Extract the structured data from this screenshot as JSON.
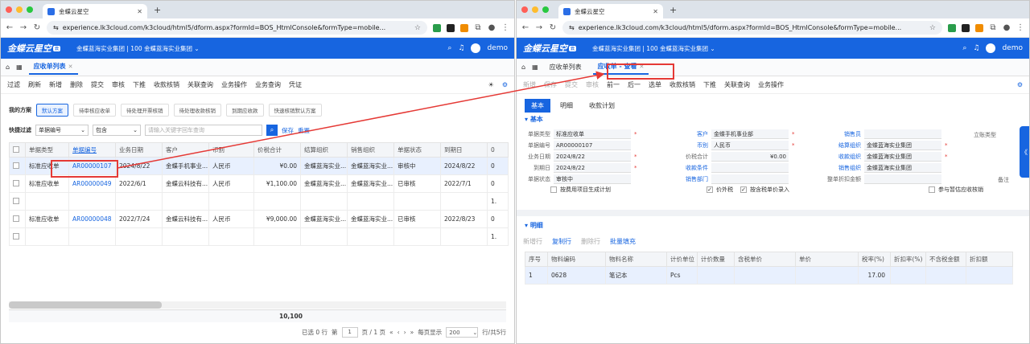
{
  "browser": {
    "tab_title": "金蝶云星空",
    "url": "experience.lk3cloud.com/k3cloud/html5/dform.aspx?formId=BOS_HtmlConsole&formType=mobile...",
    "traffic_colors": [
      "#ff5f57",
      "#febc2e",
      "#28c840"
    ]
  },
  "app": {
    "logo_text": "金蝶云星空",
    "logo_badge": "云",
    "org_label": "金蝶蓝海实业集团 | 100 金蝶蓝海实业集团",
    "org_chevron": "⌄",
    "user": "demo",
    "accent": "#1765e0",
    "highlight": "#e53935"
  },
  "left": {
    "page_tab": "应收单列表",
    "toolbar": [
      "过滤",
      "刷新",
      "新增",
      "删除",
      "提交",
      "审核",
      "下推",
      "收款核销",
      "关联查询",
      "业务操作",
      "业务查询",
      "凭证"
    ],
    "scheme_label": "我的方案",
    "schemes": [
      "默认方案",
      "待审核应收单",
      "待处理开票核销",
      "待处理收款核销",
      "到期应收款",
      "快速核销默认方案"
    ],
    "quick_filter_label": "快捷过滤",
    "filter_field": "单据编号",
    "filter_op": "包含",
    "filter_placeholder": "请输入关键字回车查询",
    "save_link": "保存",
    "reset_link": "重置",
    "columns": [
      "单据类型",
      "单据编号",
      "业务日期",
      "客户",
      "币别",
      "价税合计",
      "结算组织",
      "销售组织",
      "单据状态",
      "到期日",
      "0"
    ],
    "rows": [
      [
        "标准应收单",
        "AR00000107",
        "2024/8/22",
        "金蝶手机事业...",
        "人民币",
        "¥0.00",
        "金蝶蓝海实业...",
        "金蝶蓝海实业...",
        "审核中",
        "2024/8/22",
        "0"
      ],
      [
        "标准应收单",
        "AR00000049",
        "2022/6/1",
        "金蝶云科技有...",
        "人民币",
        "¥1,100.00",
        "金蝶蓝海实业...",
        "金蝶蓝海实业...",
        "已审核",
        "2022/7/1",
        "0"
      ],
      [
        "",
        "",
        "",
        "",
        "",
        "",
        "",
        "",
        "",
        "",
        "1."
      ],
      [
        "标准应收单",
        "AR00000048",
        "2022/7/24",
        "金蝶云科技有...",
        "人民币",
        "¥9,000.00",
        "金蝶蓝海实业...",
        "金蝶蓝海实业...",
        "已审核",
        "2022/8/23",
        "0"
      ],
      [
        "",
        "",
        "",
        "",
        "",
        "",
        "",
        "",
        "",
        "",
        "1."
      ]
    ],
    "total": "10,100",
    "footer": {
      "selected": "已选 0 行",
      "page_prefix": "第",
      "page": "1",
      "page_suffix": "页 / 1 页",
      "per_page_label": "每页显示",
      "per_page": "200",
      "rows_total": "行/共5行"
    }
  },
  "right": {
    "page_tabs": [
      "应收单列表",
      "应收单 - 查看"
    ],
    "toolbar": [
      "新增",
      "保存",
      "提交",
      "审核",
      "前一",
      "后一",
      "选单",
      "收款核销",
      "下推",
      "关联查询",
      "业务操作"
    ],
    "form_tabs": [
      "基本",
      "明细",
      "收款计划"
    ],
    "section_basic": "基本",
    "fields": {
      "doc_type_label": "单据类型",
      "doc_type": "标准应收单",
      "doc_no_label": "单据编号",
      "doc_no": "AR00000107",
      "biz_date_label": "业务日期",
      "biz_date": "2024/8/22",
      "due_date_label": "到期日",
      "due_date": "2024/8/22",
      "status_label": "单据状态",
      "status": "审核中",
      "customer_label": "客户",
      "customer": "金蝶手机事业部",
      "currency_label": "币别",
      "currency": "人民币",
      "total_label": "价税合计",
      "total": "¥0.00",
      "terms_label": "收款条件",
      "sales_dept_label": "销售部门",
      "salesman_label": "销售员",
      "settle_org_label": "结算组织",
      "settle_org": "金蝶蓝海实业集团",
      "collect_org_label": "收款组织",
      "collect_org": "金蝶蓝海实业集团",
      "sales_org_label": "销售组织",
      "sales_org": "金蝶蓝海实业集团",
      "discount_label": "整单折扣金额",
      "account_type_label": "立账类型",
      "remark_label": "备注",
      "chk_plan": "按费用项目生成计划",
      "chk_tax": "价外税",
      "chk_price": "按含税单价录入",
      "chk_aging": "参与暂估应收核销"
    },
    "section_detail": "明细",
    "detail_toolbar": [
      "新增行",
      "复制行",
      "删除行",
      "批量填充"
    ],
    "detail_columns": [
      "序号",
      "物料编码",
      "物料名称",
      "计价单位",
      "计价数量",
      "含税单价",
      "单价",
      "税率(%)",
      "折扣率(%)",
      "不含税金额",
      "折扣额"
    ],
    "detail_rows": [
      [
        "1",
        "0628",
        "笔记本",
        "Pcs",
        "",
        "",
        "",
        "17.00",
        "",
        "",
        ""
      ]
    ],
    "side_tab": "《"
  }
}
